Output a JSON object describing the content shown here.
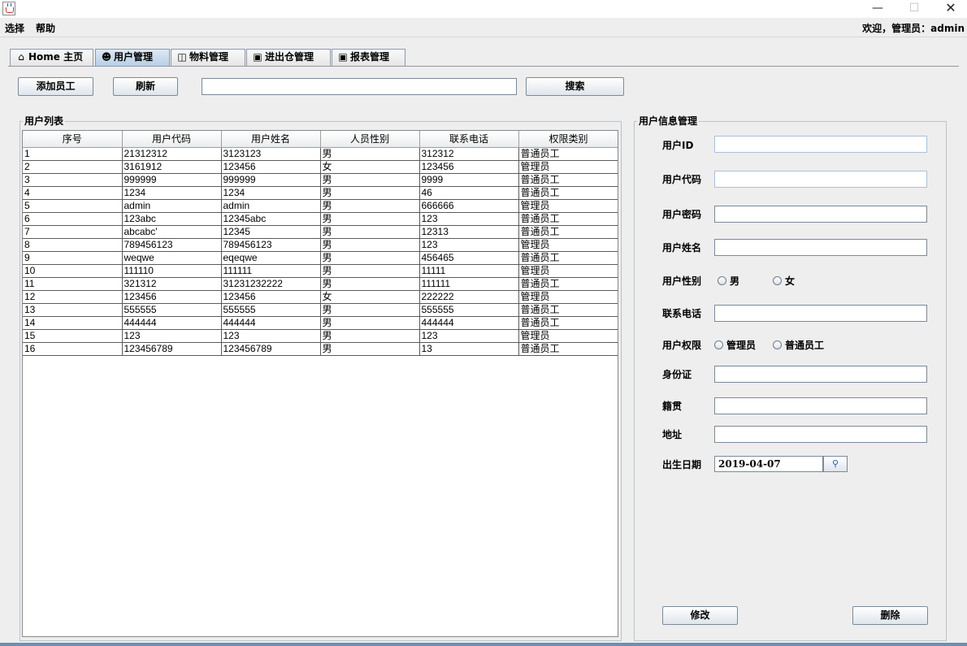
{
  "menu": {
    "items": [
      "选择",
      "帮助"
    ],
    "welcome": "欢迎，管理员：admin"
  },
  "tabs": [
    {
      "label": "Home 主页",
      "icon": "home-icon"
    },
    {
      "label": "用户管理",
      "icon": "users-icon"
    },
    {
      "label": "物料管理",
      "icon": "bag-icon"
    },
    {
      "label": "进出仓管理",
      "icon": "box-icon"
    },
    {
      "label": "报表管理",
      "icon": "report-icon"
    }
  ],
  "toolbar": {
    "add_label": "添加员工",
    "refresh_label": "刷新",
    "search_value": "",
    "search_label": "搜索"
  },
  "user_list": {
    "title": "用户列表",
    "columns": [
      "序号",
      "用户代码",
      "用户姓名",
      "人员性别",
      "联系电话",
      "权限类别"
    ],
    "rows": [
      [
        "1",
        "21312312",
        "3123123",
        "男",
        "312312",
        "普通员工"
      ],
      [
        "2",
        "3161912",
        "123456",
        "女",
        "123456",
        "管理员"
      ],
      [
        "3",
        "999999",
        "999999",
        "男",
        "9999",
        "普通员工"
      ],
      [
        "4",
        "1234",
        "1234",
        "男",
        "46",
        "普通员工"
      ],
      [
        "5",
        "admin",
        "admin",
        "男",
        "666666",
        "管理员"
      ],
      [
        "6",
        "123abc",
        "12345abc",
        "男",
        "123",
        "普通员工"
      ],
      [
        "7",
        "abcabc'",
        "12345",
        "男",
        "12313",
        "普通员工"
      ],
      [
        "8",
        "789456123",
        "789456123",
        "男",
        "123",
        "管理员"
      ],
      [
        "9",
        "weqwe",
        "eqeqwe",
        "男",
        "456465",
        "普通员工"
      ],
      [
        "10",
        "111110",
        "111111",
        "男",
        "11111",
        "管理员"
      ],
      [
        "11",
        "321312",
        "31231232222",
        "男",
        "111111",
        "普通员工"
      ],
      [
        "12",
        "123456",
        "123456",
        "女",
        "222222",
        "管理员"
      ],
      [
        "13",
        "555555",
        "555555",
        "男",
        "555555",
        "普通员工"
      ],
      [
        "14",
        "444444",
        "444444",
        "男",
        "444444",
        "普通员工"
      ],
      [
        "15",
        "123",
        "123",
        "男",
        "123",
        "管理员"
      ],
      [
        "16",
        "123456789",
        "123456789",
        "男",
        "13",
        "普通员工"
      ]
    ]
  },
  "form": {
    "title": "用户信息管理",
    "user_id_label": "用户ID",
    "user_code_label": "用户代码",
    "password_label": "用户密码",
    "name_label": "用户姓名",
    "gender_label": "用户性别",
    "gender_male": "男",
    "gender_female": "女",
    "phone_label": "联系电话",
    "role_label": "用户权限",
    "role_admin": "管理员",
    "role_staff": "普通员工",
    "id_card_label": "身份证",
    "native_place_label": "籍贯",
    "address_label": "地址",
    "birth_label": "出生日期",
    "birth_value": "2019-04-07",
    "edit_label": "修改",
    "delete_label": "删除"
  }
}
